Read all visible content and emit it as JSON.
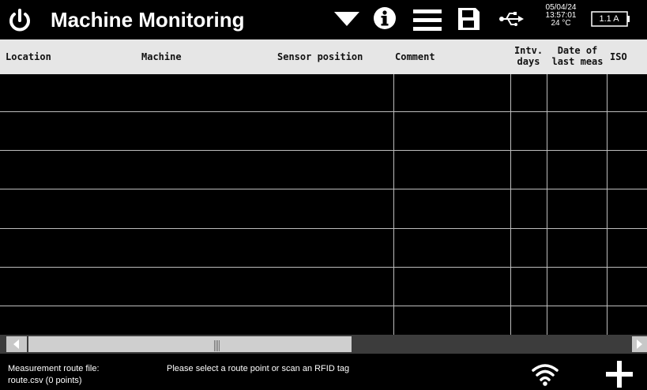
{
  "titlebar": {
    "title": "Machine Monitoring",
    "icons": [
      "power-icon",
      "dropdown-arrow-icon",
      "info-icon",
      "menu-icon",
      "save-icon",
      "usb-icon"
    ]
  },
  "status": {
    "date": "05/04/24",
    "time": "13:57:01",
    "temperature": "24 °C",
    "battery": "1.1 A"
  },
  "table": {
    "columns": [
      {
        "label": "Location"
      },
      {
        "label": "Machine"
      },
      {
        "label": "Sensor position"
      },
      {
        "label": "Comment"
      },
      {
        "label_line1": "Intv.",
        "label_line2": "days"
      },
      {
        "label_line1": "Date of",
        "label_line2": "last meas"
      },
      {
        "label": "ISO"
      }
    ],
    "rows": []
  },
  "footer": {
    "route_label": "Measurement route file:",
    "route_file": "route.csv (0 points)",
    "message": "Please select a route point or scan an RFID tag"
  },
  "colors": {
    "background": "#000000",
    "header_bg": "#e6e6e6",
    "grid": "#bdbdbd",
    "scrollbar": "#c8c8c8"
  }
}
